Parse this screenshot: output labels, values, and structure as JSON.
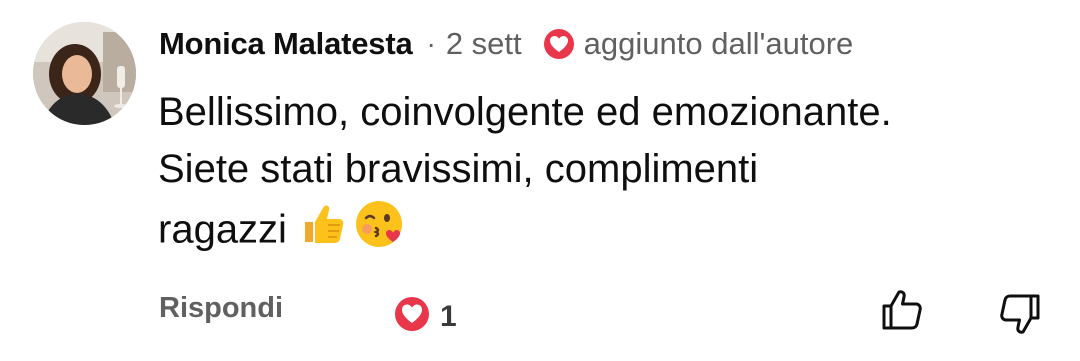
{
  "comment": {
    "author": "Monica Malatesta",
    "separator": "·",
    "time": "2 sett",
    "pinned_label": "aggiunto dall'autore",
    "body_lines": [
      "Bellissimo, coinvolgente ed emozionante.",
      "Siete stati bravissimi, complimenti",
      "ragazzi"
    ],
    "emojis": [
      "thumbs-up-emoji",
      "kissing-face-heart-emoji"
    ]
  },
  "actions": {
    "reply_label": "Rispondi",
    "heart_count": "1",
    "like_icon": "thumb-up-icon",
    "dislike_icon": "thumb-down-icon"
  },
  "colors": {
    "heart_red": "#e8364b",
    "secondary_text": "#606060",
    "primary_text": "#0f0f0f"
  }
}
